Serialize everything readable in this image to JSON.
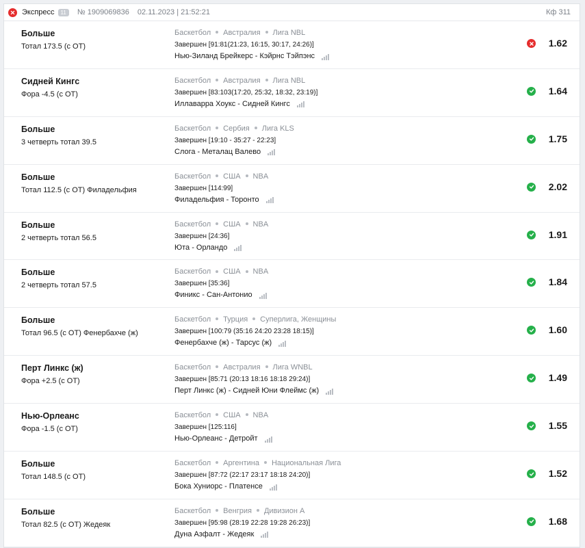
{
  "header": {
    "title": "Экспресс",
    "count": "11",
    "number": "№ 1909069836",
    "datetime": "02.11.2023 | 21:52:21",
    "kf": "Кф 311"
  },
  "colors": {
    "win": "#25b04a",
    "lose": "#e52d2d"
  },
  "bets": [
    {
      "pick": "Больше",
      "market": "Тотал 173.5 (с ОТ)",
      "sport": "Баскетбол",
      "country": "Австралия",
      "league": "Лига NBL",
      "status": "Завершен [91:81(21:23, 16:15, 30:17, 24:26)]",
      "teams": "Нью-Зиланд Брейкерс - Кэйрнс Тэйпэнс",
      "result": "lose",
      "odds": "1.62"
    },
    {
      "pick": "Сидней Кингс",
      "market": "Фора -4.5 (с ОТ)",
      "sport": "Баскетбол",
      "country": "Австралия",
      "league": "Лига NBL",
      "status": "Завершен [83:103(17:20, 25:32, 18:32, 23:19)]",
      "teams": "Иллаварра Хоукс - Сидней Кингс",
      "result": "win",
      "odds": "1.64"
    },
    {
      "pick": "Больше",
      "market": "3 четверть тотал 39.5",
      "sport": "Баскетбол",
      "country": "Сербия",
      "league": "Лига KLS",
      "status": "Завершен [19:10 - 35:27 - 22:23]",
      "teams": "Слога - Металац Валево",
      "result": "win",
      "odds": "1.75"
    },
    {
      "pick": "Больше",
      "market": "Тотал 112.5 (с ОТ) Филадельфия",
      "sport": "Баскетбол",
      "country": "США",
      "league": "NBA",
      "status": "Завершен [114:99]",
      "teams": "Филадельфия - Торонто",
      "result": "win",
      "odds": "2.02"
    },
    {
      "pick": "Больше",
      "market": "2 четверть тотал 56.5",
      "sport": "Баскетбол",
      "country": "США",
      "league": "NBA",
      "status": "Завершен [24:36]",
      "teams": "Юта - Орландо",
      "result": "win",
      "odds": "1.91"
    },
    {
      "pick": "Больше",
      "market": "2 четверть тотал 57.5",
      "sport": "Баскетбол",
      "country": "США",
      "league": "NBA",
      "status": "Завершен [35:36]",
      "teams": "Финикс - Сан-Антонио",
      "result": "win",
      "odds": "1.84"
    },
    {
      "pick": "Больше",
      "market": "Тотал 96.5 (с ОТ) Фенербахче (ж)",
      "sport": "Баскетбол",
      "country": "Турция",
      "league": "Суперлига, Женщины",
      "status": "Завершен [100:79 (35:16 24:20 23:28 18:15)]",
      "teams": "Фенербахче (ж) - Тарсус (ж)",
      "result": "win",
      "odds": "1.60"
    },
    {
      "pick": "Перт Линкс (ж)",
      "market": "Фора +2.5 (с ОТ)",
      "sport": "Баскетбол",
      "country": "Австралия",
      "league": "Лига WNBL",
      "status": "Завершен [85:71 (20:13 18:16 18:18 29:24)]",
      "teams": "Перт Линкс (ж) - Сидней Юни Флеймс (ж)",
      "result": "win",
      "odds": "1.49"
    },
    {
      "pick": "Нью-Орлеанс",
      "market": "Фора -1.5 (с ОТ)",
      "sport": "Баскетбол",
      "country": "США",
      "league": "NBA",
      "status": "Завершен [125:116]",
      "teams": "Нью-Орлеанс - Детройт",
      "result": "win",
      "odds": "1.55"
    },
    {
      "pick": "Больше",
      "market": "Тотал 148.5 (с ОТ)",
      "sport": "Баскетбол",
      "country": "Аргентина",
      "league": "Национальная Лига",
      "status": "Завершен [87:72 (22:17 23:17 18:18 24:20)]",
      "teams": "Бока Хуниорс - Платенсе",
      "result": "win",
      "odds": "1.52"
    },
    {
      "pick": "Больше",
      "market": "Тотал 82.5 (с ОТ) Жедеяк",
      "sport": "Баскетбол",
      "country": "Венгрия",
      "league": "Дивизион А",
      "status": "Завершен [95:98 (28:19 22:28 19:28 26:23)]",
      "teams": "Дуна Азфалт - Жедеяк",
      "result": "win",
      "odds": "1.68"
    }
  ]
}
